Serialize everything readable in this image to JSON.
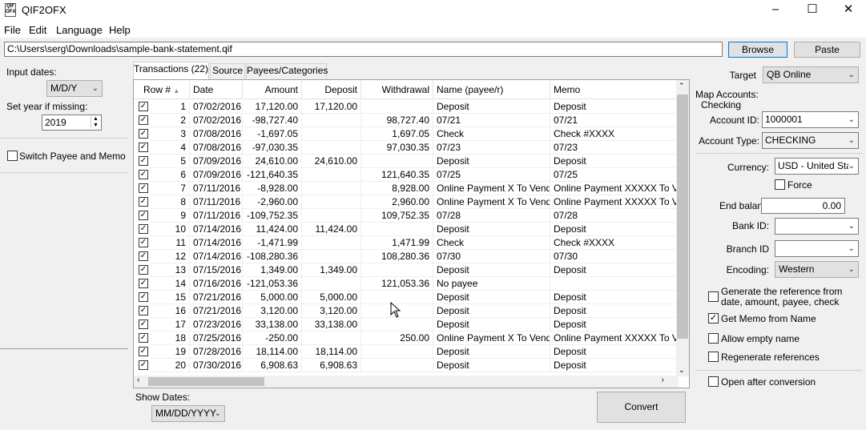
{
  "window": {
    "title": "QIF2OFX",
    "icon_text": "QIF OFX"
  },
  "menu": [
    "File",
    "Edit",
    "Language",
    "Help"
  ],
  "path": {
    "value": "C:\\Users\\serg\\Downloads\\sample-bank-statement.qif"
  },
  "buttons": {
    "browse": "Browse",
    "paste": "Paste",
    "convert": "Convert"
  },
  "left": {
    "input_dates_label": "Input dates:",
    "input_dates_value": "M/D/Y",
    "set_year_label": "Set year if missing:",
    "set_year_value": "2019",
    "switch_label": "Switch Payee and Memo"
  },
  "tabs": [
    "Transactions (22)",
    "Source",
    "Payees/Categories"
  ],
  "grid": {
    "columns": [
      "Row #",
      "Date",
      "Amount",
      "Deposit",
      "Withdrawal",
      "Name (payee/r)",
      "Memo"
    ],
    "rows": [
      {
        "n": "1",
        "date": "07/02/2016",
        "amount": "17,120.00",
        "deposit": "17,120.00",
        "withdrawal": "",
        "name": "Deposit",
        "memo": "Deposit"
      },
      {
        "n": "2",
        "date": "07/02/2016",
        "amount": "-98,727.40",
        "deposit": "",
        "withdrawal": "98,727.40",
        "name": "07/21",
        "memo": "07/21"
      },
      {
        "n": "3",
        "date": "07/08/2016",
        "amount": "-1,697.05",
        "deposit": "",
        "withdrawal": "1,697.05",
        "name": "Check",
        "memo": "Check #XXXX"
      },
      {
        "n": "4",
        "date": "07/08/2016",
        "amount": "-97,030.35",
        "deposit": "",
        "withdrawal": "97,030.35",
        "name": "07/23",
        "memo": "07/23"
      },
      {
        "n": "5",
        "date": "07/09/2016",
        "amount": "24,610.00",
        "deposit": "24,610.00",
        "withdrawal": "",
        "name": "Deposit",
        "memo": "Deposit"
      },
      {
        "n": "6",
        "date": "07/09/2016",
        "amount": "-121,640.35",
        "deposit": "",
        "withdrawal": "121,640.35",
        "name": "07/25",
        "memo": "07/25"
      },
      {
        "n": "7",
        "date": "07/11/2016",
        "amount": "-8,928.00",
        "deposit": "",
        "withdrawal": "8,928.00",
        "name": "Online Payment X To Vendor",
        "memo": "Online Payment XXXXX To Vendo"
      },
      {
        "n": "8",
        "date": "07/11/2016",
        "amount": "-2,960.00",
        "deposit": "",
        "withdrawal": "2,960.00",
        "name": "Online Payment X To Vendor",
        "memo": "Online Payment XXXXX To Vendo"
      },
      {
        "n": "9",
        "date": "07/11/2016",
        "amount": "-109,752.35",
        "deposit": "",
        "withdrawal": "109,752.35",
        "name": "07/28",
        "memo": "07/28"
      },
      {
        "n": "10",
        "date": "07/14/2016",
        "amount": "11,424.00",
        "deposit": "11,424.00",
        "withdrawal": "",
        "name": "Deposit",
        "memo": "Deposit"
      },
      {
        "n": "11",
        "date": "07/14/2016",
        "amount": "-1,471.99",
        "deposit": "",
        "withdrawal": "1,471.99",
        "name": "Check",
        "memo": "Check #XXXX"
      },
      {
        "n": "12",
        "date": "07/14/2016",
        "amount": "-108,280.36",
        "deposit": "",
        "withdrawal": "108,280.36",
        "name": "07/30",
        "memo": "07/30"
      },
      {
        "n": "13",
        "date": "07/15/2016",
        "amount": "1,349.00",
        "deposit": "1,349.00",
        "withdrawal": "",
        "name": "Deposit",
        "memo": "Deposit"
      },
      {
        "n": "14",
        "date": "07/16/2016",
        "amount": "-121,053.36",
        "deposit": "",
        "withdrawal": "121,053.36",
        "name": "No payee",
        "memo": ""
      },
      {
        "n": "15",
        "date": "07/21/2016",
        "amount": "5,000.00",
        "deposit": "5,000.00",
        "withdrawal": "",
        "name": "Deposit",
        "memo": "Deposit"
      },
      {
        "n": "16",
        "date": "07/21/2016",
        "amount": "3,120.00",
        "deposit": "3,120.00",
        "withdrawal": "",
        "name": "Deposit",
        "memo": "Deposit"
      },
      {
        "n": "17",
        "date": "07/23/2016",
        "amount": "33,138.00",
        "deposit": "33,138.00",
        "withdrawal": "",
        "name": "Deposit",
        "memo": "Deposit"
      },
      {
        "n": "18",
        "date": "07/25/2016",
        "amount": "-250.00",
        "deposit": "",
        "withdrawal": "250.00",
        "name": "Online Payment X To Vendor",
        "memo": "Online Payment XXXXX To Vendo"
      },
      {
        "n": "19",
        "date": "07/28/2016",
        "amount": "18,114.00",
        "deposit": "18,114.00",
        "withdrawal": "",
        "name": "Deposit",
        "memo": "Deposit"
      },
      {
        "n": "20",
        "date": "07/30/2016",
        "amount": "6,908.63",
        "deposit": "6,908.63",
        "withdrawal": "",
        "name": "Deposit",
        "memo": "Deposit"
      }
    ]
  },
  "show_dates": {
    "label": "Show Dates:",
    "value": "MM/DD/YYYY"
  },
  "right": {
    "target_label": "Target",
    "target_value": "QB Online",
    "map_accounts_label": "Map Accounts:",
    "checking_label": "Checking",
    "account_id_label": "Account ID:",
    "account_id_value": "1000001",
    "account_type_label": "Account Type:",
    "account_type_value": "CHECKING",
    "currency_label": "Currency:",
    "currency_value": "USD - United Sta",
    "force_label": "Force",
    "end_balance_label": "End balanc",
    "end_balance_value": "0.00",
    "bank_id_label": "Bank ID:",
    "branch_id_label": "Branch ID",
    "encoding_label": "Encoding:",
    "encoding_value": "Western",
    "gen_ref_label": "Generate the reference from date, amount, payee, check",
    "get_memo_label": "Get Memo from Name",
    "allow_empty_label": "Allow empty name",
    "regen_label": "Regenerate references",
    "open_after_label": "Open after conversion"
  }
}
